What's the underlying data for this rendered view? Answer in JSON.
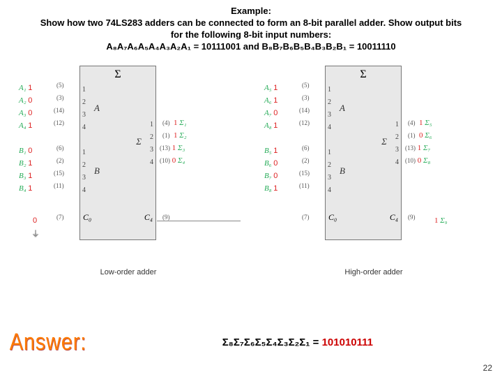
{
  "heading": {
    "title": "Example:",
    "line1": "Show how two 74LS283 adders can be connected to form an 8-bit parallel adder. Show output bits for the following 8-bit input numbers:",
    "line2": "A₈A₇A₆A₅A₄A₃A₂A₁ = 10111001 and B₈B₇B₆B₅B₄B₃B₂B₁ = 10011110"
  },
  "adders": {
    "low": {
      "caption": "Low-order adder",
      "A": [
        {
          "label": "A₁",
          "val": "1",
          "pin": "(5)",
          "inner": "1"
        },
        {
          "label": "A₂",
          "val": "0",
          "pin": "(3)",
          "inner": "2"
        },
        {
          "label": "A₃",
          "val": "0",
          "pin": "(14)",
          "inner": "3"
        },
        {
          "label": "A₄",
          "val": "1",
          "pin": "(12)",
          "inner": "4"
        }
      ],
      "B": [
        {
          "label": "B₁",
          "val": "0",
          "pin": "(6)",
          "inner": "1"
        },
        {
          "label": "B₂",
          "val": "1",
          "pin": "(2)",
          "inner": "2"
        },
        {
          "label": "B₃",
          "val": "1",
          "pin": "(15)",
          "inner": "3"
        },
        {
          "label": "B₄",
          "val": "1",
          "pin": "(11)",
          "inner": "4"
        }
      ],
      "S": [
        {
          "label": "Σ₁",
          "val": "1",
          "pin": "(4)",
          "inner": "1"
        },
        {
          "label": "Σ₂",
          "val": "1",
          "pin": "(1)",
          "inner": "2"
        },
        {
          "label": "Σ₃",
          "val": "1",
          "pin": "(13)",
          "inner": "3"
        },
        {
          "label": "Σ₄",
          "val": "0",
          "pin": "(10)",
          "inner": "4"
        }
      ],
      "C0": {
        "label": "C₀",
        "val": "0",
        "pin": "(7)"
      },
      "C4": {
        "label": "C₄",
        "pin": "(9)"
      },
      "brace_A": "A",
      "brace_B": "B",
      "brace_S": "Σ",
      "sigma_top": "Σ"
    },
    "high": {
      "caption": "High-order adder",
      "A": [
        {
          "label": "A₅",
          "val": "1",
          "pin": "(5)",
          "inner": "1"
        },
        {
          "label": "A₆",
          "val": "1",
          "pin": "(3)",
          "inner": "2"
        },
        {
          "label": "A₇",
          "val": "0",
          "pin": "(14)",
          "inner": "3"
        },
        {
          "label": "A₈",
          "val": "1",
          "pin": "(12)",
          "inner": "4"
        }
      ],
      "B": [
        {
          "label": "B₅",
          "val": "1",
          "pin": "(6)",
          "inner": "1"
        },
        {
          "label": "B₆",
          "val": "0",
          "pin": "(2)",
          "inner": "2"
        },
        {
          "label": "B₇",
          "val": "0",
          "pin": "(15)",
          "inner": "3"
        },
        {
          "label": "B₈",
          "val": "1",
          "pin": "(11)",
          "inner": "4"
        }
      ],
      "S": [
        {
          "label": "Σ₅",
          "val": "1",
          "pin": "(4)",
          "inner": "1"
        },
        {
          "label": "Σ₆",
          "val": "0",
          "pin": "(1)",
          "inner": "2"
        },
        {
          "label": "Σ₇",
          "val": "1",
          "pin": "(13)",
          "inner": "3"
        },
        {
          "label": "Σ₈",
          "val": "0",
          "pin": "(10)",
          "inner": "4"
        }
      ],
      "C0": {
        "label": "C₀",
        "pin": "(7)"
      },
      "C4": {
        "label": "C₄",
        "pin": "(9)"
      },
      "C4out": {
        "val": "1",
        "label": "Σ₉"
      },
      "brace_A": "A",
      "brace_B": "B",
      "brace_S": "Σ",
      "sigma_top": "Σ"
    }
  },
  "answer": {
    "art": "Answer:",
    "sigma": "Σ₈Σ₇Σ₆Σ₅Σ₄Σ₃Σ₂Σ₁ = ",
    "bits": "101010111"
  },
  "pagenum": "22",
  "ground_symbol": "⏚"
}
